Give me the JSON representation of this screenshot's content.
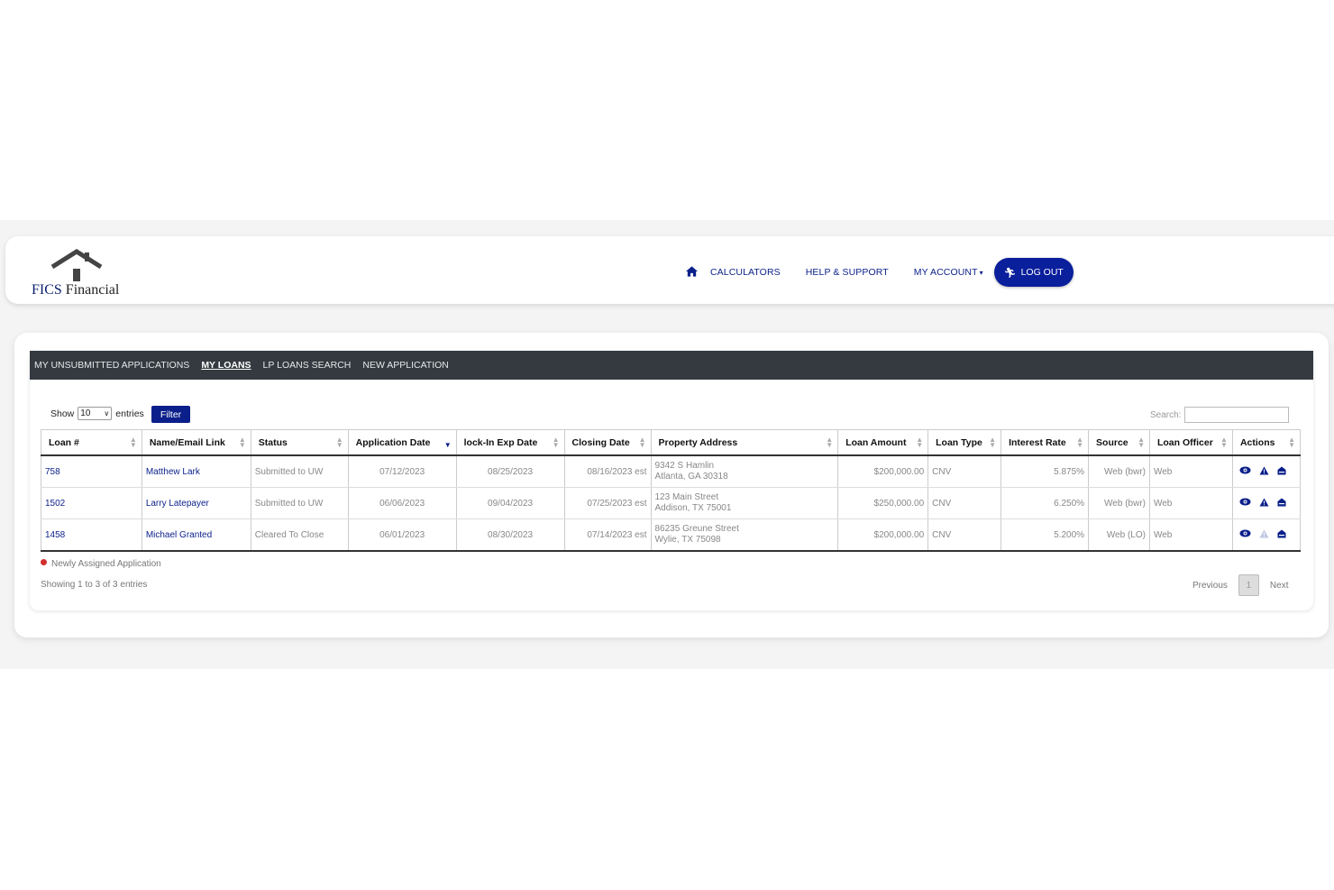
{
  "brand": {
    "logo_text_blue": "FICS",
    "logo_text_dark": "Financial"
  },
  "nav": {
    "calculators": "CALCULATORS",
    "help": "HELP & SUPPORT",
    "account": "MY ACCOUNT",
    "logout": "LOG OUT"
  },
  "tabs": [
    {
      "label": "MY UNSUBMITTED APPLICATIONS",
      "active": false
    },
    {
      "label": "MY LOANS",
      "active": true
    },
    {
      "label": "LP LOANS SEARCH",
      "active": false
    },
    {
      "label": "NEW APPLICATION",
      "active": false
    }
  ],
  "controls": {
    "show_label": "Show",
    "entries_value": "10",
    "entries_label": "entries",
    "filter_label": "Filter",
    "search_label": "Search:"
  },
  "table": {
    "headers": [
      "Loan #",
      "Name/Email Link",
      "Status",
      "Application Date",
      "lock-In Exp Date",
      "Closing Date",
      "Property Address",
      "Loan Amount",
      "Loan Type",
      "Interest Rate",
      "Source",
      "Loan Officer",
      "Actions"
    ],
    "rows": [
      {
        "loan": "758",
        "name": "Matthew Lark",
        "status": "Submitted to UW",
        "app_date": "07/12/2023",
        "lock_date": "08/25/2023",
        "closing": "08/16/2023 est",
        "addr1": "9342 S Hamlin",
        "addr2": "Atlanta, GA 30318",
        "amount": "$200,000.00",
        "type": "CNV",
        "rate": "5.875%",
        "source": "Web (bwr)",
        "officer": "Web",
        "warn_active": true
      },
      {
        "loan": "1502",
        "name": "Larry Latepayer",
        "status": "Submitted to UW",
        "app_date": "06/06/2023",
        "lock_date": "09/04/2023",
        "closing": "07/25/2023 est",
        "addr1": "123 Main Street",
        "addr2": "Addison, TX 75001",
        "amount": "$250,000.00",
        "type": "CNV",
        "rate": "6.250%",
        "source": "Web (bwr)",
        "officer": "Web",
        "warn_active": true
      },
      {
        "loan": "1458",
        "name": "Michael Granted",
        "status": "Cleared To Close",
        "app_date": "06/01/2023",
        "lock_date": "08/30/2023",
        "closing": "07/14/2023 est",
        "addr1": "86235 Greune Street",
        "addr2": "Wylie, TX 75098",
        "amount": "$200,000.00",
        "type": "CNV",
        "rate": "5.200%",
        "source": "Web (LO)",
        "officer": "Web",
        "warn_active": false
      }
    ]
  },
  "legend": "Newly Assigned Application",
  "info": "Showing 1 to 3 of 3 entries",
  "pager": {
    "previous": "Previous",
    "page": "1",
    "next": "Next"
  },
  "colors": {
    "brand_blue": "#0a1f8a",
    "tabbar": "#343a40",
    "new_dot": "#d32f2f"
  }
}
